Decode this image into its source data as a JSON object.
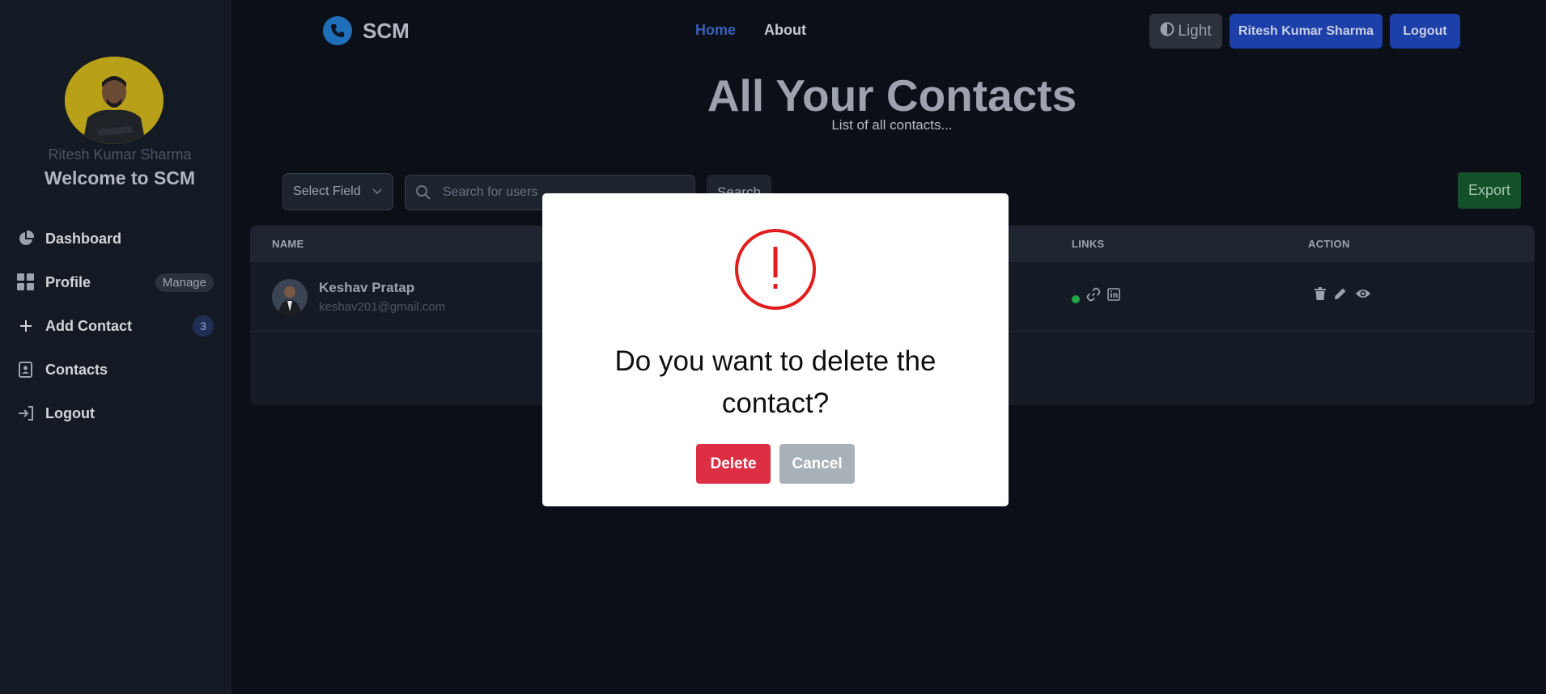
{
  "brand": {
    "name": "SCM"
  },
  "topnav": {
    "home": "Home",
    "about": "About",
    "theme_toggle": "Light",
    "user_button": "Ritesh Kumar Sharma",
    "logout": "Logout",
    "home_color": "#3b5fb8",
    "about_color": "#c5cad2"
  },
  "sidebar": {
    "username": "Ritesh Kumar Sharma",
    "welcome": "Welcome to SCM",
    "items": [
      {
        "label": "Dashboard",
        "icon": "pie-chart-icon"
      },
      {
        "label": "Profile",
        "icon": "grid-icon",
        "badge": "Manage"
      },
      {
        "label": "Add Contact",
        "icon": "plus-icon",
        "badge": "3"
      },
      {
        "label": "Contacts",
        "icon": "contact-book-icon"
      },
      {
        "label": "Logout",
        "icon": "sign-in-icon"
      }
    ]
  },
  "page": {
    "title": "All Your Contacts",
    "subtitle": "List of all contacts..."
  },
  "filters": {
    "select_field": "Select Field",
    "search_placeholder": "Search for users",
    "search_button": "Search",
    "export_button": "Export"
  },
  "table": {
    "columns": [
      "NAME",
      "LINKS",
      "ACTION"
    ],
    "rows": [
      {
        "name": "Keshav Pratap",
        "email": "keshav201@gmail.com"
      }
    ]
  },
  "modal": {
    "message": "Do you want to delete the contact?",
    "confirm": "Delete",
    "cancel": "Cancel",
    "icon_color": "#e11d1d"
  }
}
